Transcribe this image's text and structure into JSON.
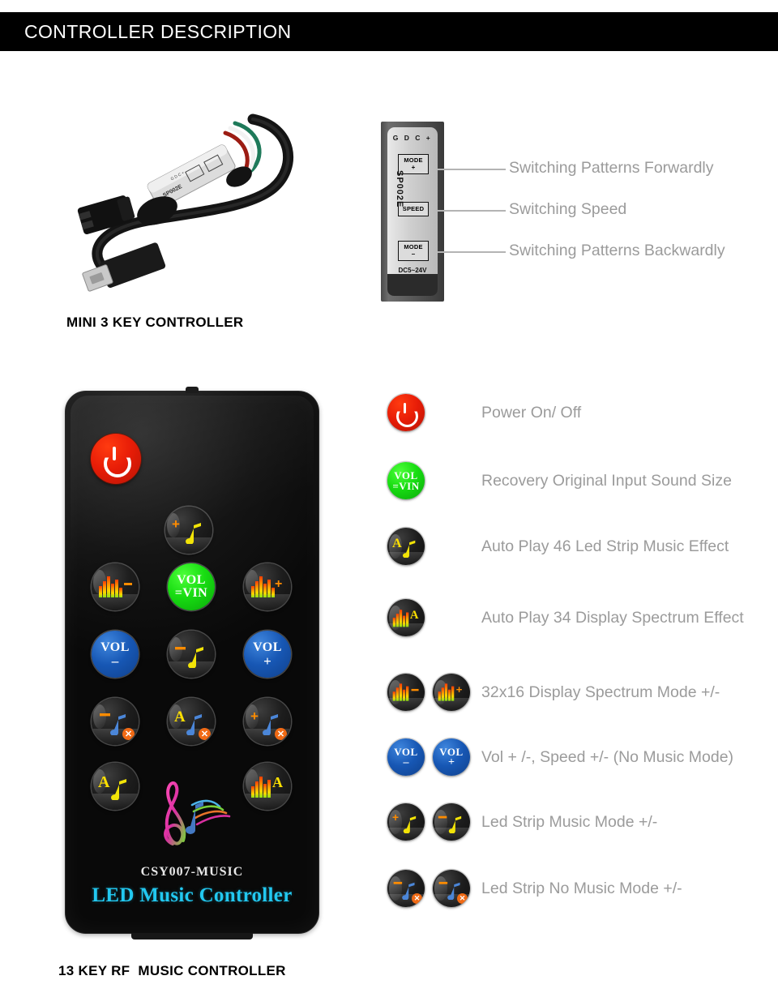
{
  "header": {
    "title": "CONTROLLER DESCRIPTION"
  },
  "section_mini": {
    "caption": "MINI 3 KEY CONTROLLER",
    "device": {
      "pin_labels": "G D C +",
      "model": "SP002E",
      "button_mode_plus_top": "MODE",
      "button_mode_plus_bottom": "+",
      "button_speed": "SPEED",
      "button_mode_minus_top": "MODE",
      "button_mode_minus_bottom": "–",
      "voltage": "DC5~24V",
      "terminal_negative": "I",
      "terminal_positive": "+"
    },
    "callouts": [
      {
        "label": "Switching Patterns Forwardly"
      },
      {
        "label": "Switching Speed"
      },
      {
        "label": "Switching Patterns Backwardly"
      }
    ]
  },
  "section_remote": {
    "caption": "13 KEY RF  MUSIC CONTROLLER",
    "model_text": "CSY007-MUSIC",
    "brand_text": "LED Music Controller",
    "keys": [
      {
        "name": "power",
        "icon": "power-icon",
        "style": "red"
      },
      {
        "name": "music-mode-plus",
        "icon": "plus-music-note-icon",
        "style": "dark",
        "sign": "+"
      },
      {
        "name": "spectrum-mode-minus",
        "icon": "spectrum-minus-icon",
        "style": "dark",
        "sign": "–"
      },
      {
        "name": "vol-equals-vin",
        "icon": "vol-vin-icon",
        "style": "green",
        "line1": "VOL",
        "line2": "=VIN"
      },
      {
        "name": "spectrum-mode-plus",
        "icon": "spectrum-plus-icon",
        "style": "dark",
        "sign": "+"
      },
      {
        "name": "volume-down",
        "icon": "vol-minus-icon",
        "style": "blue",
        "line1": "VOL",
        "sign": "–"
      },
      {
        "name": "music-mode-minus",
        "icon": "minus-music-note-icon",
        "style": "dark",
        "sign": "–"
      },
      {
        "name": "volume-up",
        "icon": "vol-plus-icon",
        "style": "blue",
        "line1": "VOL",
        "sign": "+"
      },
      {
        "name": "no-music-mode-minus",
        "icon": "minus-music-note-x-icon",
        "style": "dark",
        "sign": "–"
      },
      {
        "name": "auto-no-music-mode",
        "icon": "auto-music-note-x-icon",
        "style": "dark",
        "sign": "A"
      },
      {
        "name": "no-music-mode-plus",
        "icon": "plus-music-note-x-icon",
        "style": "dark",
        "sign": "+"
      },
      {
        "name": "auto-music-effect",
        "icon": "auto-music-note-icon",
        "style": "dark",
        "sign": "A"
      },
      {
        "name": "auto-spectrum-effect",
        "icon": "spectrum-auto-icon",
        "style": "dark",
        "sign": "A"
      }
    ]
  },
  "legend": {
    "rows": [
      {
        "label": "Power On/ Off",
        "icons": [
          "power-icon"
        ]
      },
      {
        "label": "Recovery Original Input Sound Size",
        "icons": [
          "vol-vin-icon"
        ]
      },
      {
        "label": "Auto Play 46 Led Strip Music Effect",
        "icons": [
          "auto-music-note-icon"
        ]
      },
      {
        "label": "Auto Play 34 Display Spectrum Effect",
        "icons": [
          "spectrum-auto-icon"
        ]
      },
      {
        "label": "32x16 Display Spectrum Mode +/-",
        "icons": [
          "spectrum-minus-icon",
          "spectrum-plus-icon"
        ]
      },
      {
        "label": "Vol + /-, Speed +/- (No Music Mode)",
        "icons": [
          "vol-minus-icon",
          "vol-plus-icon"
        ]
      },
      {
        "label": "Led Strip Music Mode +/-",
        "icons": [
          "plus-music-note-icon",
          "minus-music-note-icon"
        ]
      },
      {
        "label": "Led Strip No Music Mode +/-",
        "icons": [
          "minus-music-note-x-icon",
          "minus-music-note-x-icon"
        ]
      }
    ]
  },
  "colors": {
    "header_bg": "#000000",
    "header_text": "#ffffff",
    "legend_text": "#9b9b9b",
    "caption_text": "#000000",
    "power_red": "#e81d07",
    "vol_vin_green": "#18dd12",
    "vol_blue": "#1757b4",
    "note_yellow": "#f2e307",
    "note_blue": "#4b86d8",
    "sign_orange": "#ff8c00",
    "brand_cyan": "#22c8f0"
  }
}
